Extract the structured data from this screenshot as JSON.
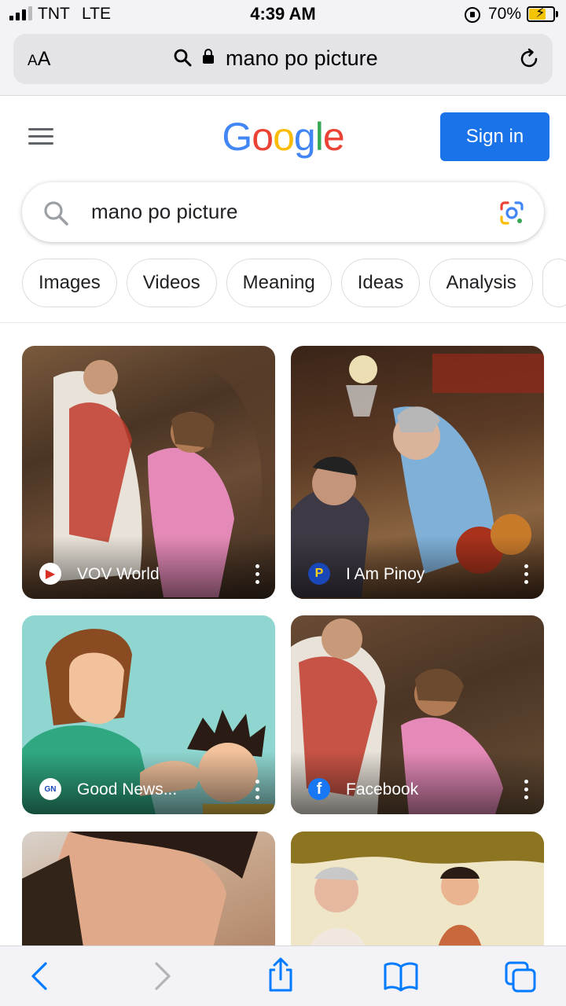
{
  "status_bar": {
    "carrier": "TNT",
    "network": "LTE",
    "time": "4:39 AM",
    "battery_percent": "70%",
    "battery_level": 0.7,
    "signal_bars": 3
  },
  "url_bar": {
    "text_size_label_small": "A",
    "text_size_label_large": "A",
    "address": "mano po picture",
    "icons": [
      "search-icon",
      "lock-icon",
      "reload-icon"
    ]
  },
  "header": {
    "logo_letters": [
      {
        "char": "G",
        "color": "#4285F4"
      },
      {
        "char": "o",
        "color": "#EA4335"
      },
      {
        "char": "o",
        "color": "#FBBC05"
      },
      {
        "char": "g",
        "color": "#4285F4"
      },
      {
        "char": "l",
        "color": "#34A853"
      },
      {
        "char": "e",
        "color": "#EA4335"
      }
    ],
    "signin_label": "Sign in",
    "accent_color": "#1a73e8"
  },
  "search": {
    "query": "mano po picture",
    "icons": [
      "search-icon",
      "google-lens-icon"
    ]
  },
  "chips": [
    "Images",
    "Videos",
    "Meaning",
    "Ideas",
    "Analysis"
  ],
  "results": [
    {
      "source": "VOV World",
      "icon": "vov-logo-icon"
    },
    {
      "source": "I Am Pinoy",
      "icon": "i-am-pinoy-logo-icon"
    },
    {
      "source": "Good News...",
      "icon": "good-news-logo-icon"
    },
    {
      "source": "Facebook",
      "icon": "facebook-logo-icon"
    }
  ],
  "toolbar": {
    "icons": [
      "back-icon",
      "forward-icon",
      "share-icon",
      "bookmarks-icon",
      "tabs-icon"
    ]
  }
}
